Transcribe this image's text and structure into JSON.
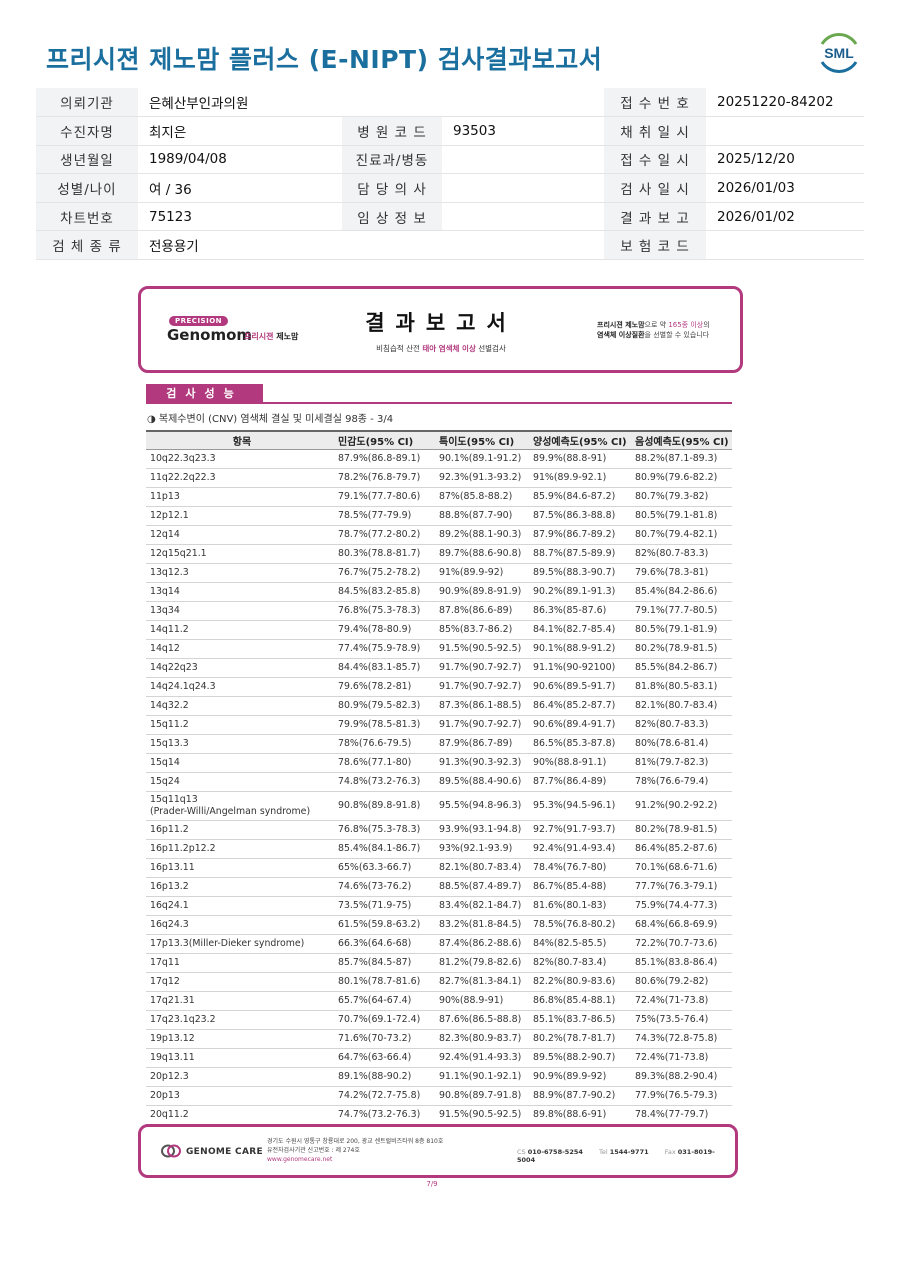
{
  "header": {
    "title": "프리시젼 제노맘 플러스 (E-NIPT) 검사결과보고서",
    "logo_text": "SML"
  },
  "info": [
    [
      {
        "label": "의뢰기관",
        "value": "은혜산부인과의원"
      },
      {
        "label": "",
        "value": ""
      },
      {
        "label": "접 수 번 호",
        "value": "20251220-84202"
      }
    ],
    [
      {
        "label": "수진자명",
        "value": "최지은"
      },
      {
        "label": "병 원 코 드",
        "value": "93503"
      },
      {
        "label": "채 취 일 시",
        "value": ""
      }
    ],
    [
      {
        "label": "생년월일",
        "value": "1989/04/08"
      },
      {
        "label": "진료과/병동",
        "value": ""
      },
      {
        "label": "접 수 일 시",
        "value": "2025/12/20"
      }
    ],
    [
      {
        "label": "성별/나이",
        "value": "여 / 36"
      },
      {
        "label": "담 당 의 사",
        "value": ""
      },
      {
        "label": "검 사 일 시",
        "value": "2026/01/03"
      }
    ],
    [
      {
        "label": "차트번호",
        "value": "75123"
      },
      {
        "label": "임 상 정 보",
        "value": ""
      },
      {
        "label": "결 과 보 고",
        "value": "2026/01/02"
      }
    ],
    [
      {
        "label": "검 체 종 류",
        "value": "전용용기"
      },
      {
        "label": "",
        "value": ""
      },
      {
        "label": "보 험 코 드",
        "value": ""
      }
    ]
  ],
  "banner": {
    "pill": "PRECISION",
    "brand": "Genomom",
    "brand_sub_1": "프리시젼",
    "brand_sub_2": "제노맘",
    "title": "결과보고서",
    "subtitle_pre": "비침습적 산전",
    "subtitle_hl": "태아 염색체 이상",
    "subtitle_post": "선별검사",
    "right_1a": "프리시젼 제노맘",
    "right_1b": "으로 약",
    "right_1c": "165종 이상",
    "right_1d": "의",
    "right_2a": "염색체 이상질환",
    "right_2b": "을 선별할 수 있습니다"
  },
  "section": {
    "title": "검사성능",
    "caption": "◑ 복제수변이 (CNV) 염색체 결실 및 미세결실 98종 - 3/4"
  },
  "table": {
    "headers": [
      "항목",
      "민감도(95% CI)",
      "특이도(95% CI)",
      "양성예측도(95% CI)",
      "음성예측도(95% CI)"
    ],
    "rows": [
      [
        "10q22.3q23.3",
        "87.9%(86.8-89.1)",
        "90.1%(89.1-91.2)",
        "89.9%(88.8-91)",
        "88.2%(87.1-89.3)"
      ],
      [
        "11q22.2q22.3",
        "78.2%(76.8-79.7)",
        "92.3%(91.3-93.2)",
        "91%(89.9-92.1)",
        "80.9%(79.6-82.2)"
      ],
      [
        "11p13",
        "79.1%(77.7-80.6)",
        "87%(85.8-88.2)",
        "85.9%(84.6-87.2)",
        "80.7%(79.3-82)"
      ],
      [
        "12p12.1",
        "78.5%(77-79.9)",
        "88.8%(87.7-90)",
        "87.5%(86.3-88.8)",
        "80.5%(79.1-81.8)"
      ],
      [
        "12q14",
        "78.7%(77.2-80.2)",
        "89.2%(88.1-90.3)",
        "87.9%(86.7-89.2)",
        "80.7%(79.4-82.1)"
      ],
      [
        "12q15q21.1",
        "80.3%(78.8-81.7)",
        "89.7%(88.6-90.8)",
        "88.7%(87.5-89.9)",
        "82%(80.7-83.3)"
      ],
      [
        "13q12.3",
        "76.7%(75.2-78.2)",
        "91%(89.9-92)",
        "89.5%(88.3-90.7)",
        "79.6%(78.3-81)"
      ],
      [
        "13q14",
        "84.5%(83.2-85.8)",
        "90.9%(89.8-91.9)",
        "90.2%(89.1-91.3)",
        "85.4%(84.2-86.6)"
      ],
      [
        "13q34",
        "76.8%(75.3-78.3)",
        "87.8%(86.6-89)",
        "86.3%(85-87.6)",
        "79.1%(77.7-80.5)"
      ],
      [
        "14q11.2",
        "79.4%(78-80.9)",
        "85%(83.7-86.2)",
        "84.1%(82.7-85.4)",
        "80.5%(79.1-81.9)"
      ],
      [
        "14q12",
        "77.4%(75.9-78.9)",
        "91.5%(90.5-92.5)",
        "90.1%(88.9-91.2)",
        "80.2%(78.9-81.5)"
      ],
      [
        "14q22q23",
        "84.4%(83.1-85.7)",
        "91.7%(90.7-92.7)",
        "91.1%(90-92100)",
        "85.5%(84.2-86.7)"
      ],
      [
        "14q24.1q24.3",
        "79.6%(78.2-81)",
        "91.7%(90.7-92.7)",
        "90.6%(89.5-91.7)",
        "81.8%(80.5-83.1)"
      ],
      [
        "14q32.2",
        "80.9%(79.5-82.3)",
        "87.3%(86.1-88.5)",
        "86.4%(85.2-87.7)",
        "82.1%(80.7-83.4)"
      ],
      [
        "15q11.2",
        "79.9%(78.5-81.3)",
        "91.7%(90.7-92.7)",
        "90.6%(89.4-91.7)",
        "82%(80.7-83.3)"
      ],
      [
        "15q13.3",
        "78%(76.6-79.5)",
        "87.9%(86.7-89)",
        "86.5%(85.3-87.8)",
        "80%(78.6-81.4)"
      ],
      [
        "15q14",
        "78.6%(77.1-80)",
        "91.3%(90.3-92.3)",
        "90%(88.8-91.1)",
        "81%(79.7-82.3)"
      ],
      [
        "15q24",
        "74.8%(73.2-76.3)",
        "89.5%(88.4-90.6)",
        "87.7%(86.4-89)",
        "78%(76.6-79.4)"
      ],
      [
        "15q11q13\n(Prader-Willi/Angelman syndrome)",
        "90.8%(89.8-91.8)",
        "95.5%(94.8-96.3)",
        "95.3%(94.5-96.1)",
        "91.2%(90.2-92.2)"
      ],
      [
        "16p11.2",
        "76.8%(75.3-78.3)",
        "93.9%(93.1-94.8)",
        "92.7%(91.7-93.7)",
        "80.2%(78.9-81.5)"
      ],
      [
        "16p11.2p12.2",
        "85.4%(84.1-86.7)",
        "93%(92.1-93.9)",
        "92.4%(91.4-93.4)",
        "86.4%(85.2-87.6)"
      ],
      [
        "16p13.11",
        "65%(63.3-66.7)",
        "82.1%(80.7-83.4)",
        "78.4%(76.7-80)",
        "70.1%(68.6-71.6)"
      ],
      [
        "16p13.2",
        "74.6%(73-76.2)",
        "88.5%(87.4-89.7)",
        "86.7%(85.4-88)",
        "77.7%(76.3-79.1)"
      ],
      [
        "16q24.1",
        "73.5%(71.9-75)",
        "83.4%(82.1-84.7)",
        "81.6%(80.1-83)",
        "75.9%(74.4-77.3)"
      ],
      [
        "16q24.3",
        "61.5%(59.8-63.2)",
        "83.2%(81.8-84.5)",
        "78.5%(76.8-80.2)",
        "68.4%(66.8-69.9)"
      ],
      [
        "17p13.3(Miller-Dieker syndrome)",
        "66.3%(64.6-68)",
        "87.4%(86.2-88.6)",
        "84%(82.5-85.5)",
        "72.2%(70.7-73.6)"
      ],
      [
        "17q11",
        "85.7%(84.5-87)",
        "81.2%(79.8-82.6)",
        "82%(80.7-83.4)",
        "85.1%(83.8-86.4)"
      ],
      [
        "17q12",
        "80.1%(78.7-81.6)",
        "82.7%(81.3-84.1)",
        "82.2%(80.9-83.6)",
        "80.6%(79.2-82)"
      ],
      [
        "17q21.31",
        "65.7%(64-67.4)",
        "90%(88.9-91)",
        "86.8%(85.4-88.1)",
        "72.4%(71-73.8)"
      ],
      [
        "17q23.1q23.2",
        "70.7%(69.1-72.4)",
        "87.6%(86.5-88.8)",
        "85.1%(83.7-86.5)",
        "75%(73.5-76.4)"
      ],
      [
        "19p13.12",
        "71.6%(70-73.2)",
        "82.3%(80.9-83.7)",
        "80.2%(78.7-81.7)",
        "74.3%(72.8-75.8)"
      ],
      [
        "19q13.11",
        "64.7%(63-66.4)",
        "92.4%(91.4-93.3)",
        "89.5%(88.2-90.7)",
        "72.4%(71-73.8)"
      ],
      [
        "20p12.3",
        "89.1%(88-90.2)",
        "91.1%(90.1-92.1)",
        "90.9%(89.9-92)",
        "89.3%(88.2-90.4)"
      ],
      [
        "20p13",
        "74.2%(72.7-75.8)",
        "90.8%(89.7-91.8)",
        "88.9%(87.7-90.2)",
        "77.9%(76.5-79.3)"
      ],
      [
        "20q11.2",
        "74.7%(73.2-76.3)",
        "91.5%(90.5-92.5)",
        "89.8%(88.6-91)",
        "78.4%(77-79.7)"
      ]
    ]
  },
  "footer": {
    "company": "GENOME CARE",
    "address_1": "경기도 수원시 영통구 창룡대로 200, 광교 센트럴비즈타워 8층 810호",
    "address_2": "유전자검사기관 신고번호 : 제 274호",
    "website": "www.genomecare.net",
    "cs_label": "CS",
    "cs_value": "010-6758-5254",
    "tel_label": "Tel",
    "tel_value": "1544-9771",
    "fax_label": "Fax",
    "fax_value": "031-8019-5004"
  },
  "page_number": "7/9",
  "colors": {
    "title": "#1b6f9e",
    "accent": "#b2397e",
    "label_bg": "#f2f3f5"
  }
}
